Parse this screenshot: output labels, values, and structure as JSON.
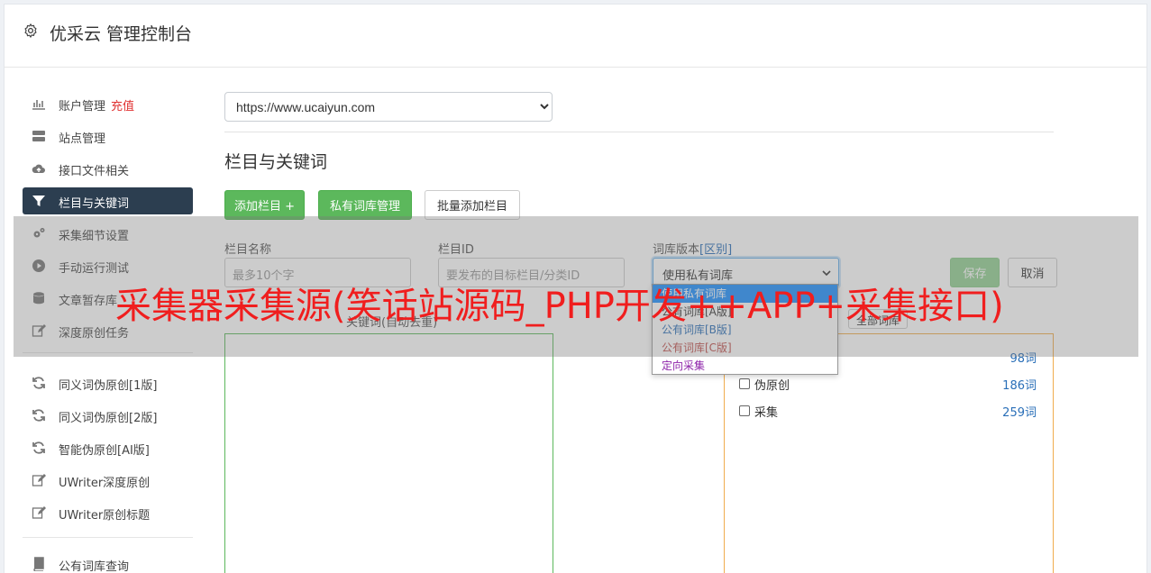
{
  "header": {
    "title": "优采云 管理控制台",
    "icon": "gear-icon"
  },
  "sidebar": {
    "items": [
      {
        "label": "账户管理",
        "extra": "充值",
        "icon": "bar-chart-icon"
      },
      {
        "label": "站点管理",
        "icon": "server-icon"
      },
      {
        "label": "接口文件相关",
        "icon": "cloud-upload-icon"
      },
      {
        "label": "栏目与关键词",
        "icon": "filter-icon",
        "active": true
      },
      {
        "label": "采集细节设置",
        "icon": "cogs-icon"
      },
      {
        "label": "手动运行测试",
        "icon": "play-circle-icon"
      },
      {
        "label": "文章暂存库",
        "icon": "database-icon"
      },
      {
        "label": "深度原创任务",
        "icon": "edit-icon"
      },
      {
        "label": "同义词伪原创[1版]",
        "icon": "refresh-icon"
      },
      {
        "label": "同义词伪原创[2版]",
        "icon": "refresh-icon"
      },
      {
        "label": "智能伪原创[AI版]",
        "icon": "refresh-icon"
      },
      {
        "label": "UWriter深度原创",
        "icon": "edit-icon"
      },
      {
        "label": "UWriter原创标题",
        "icon": "edit-icon"
      },
      {
        "label": "公有词库查询",
        "icon": "book-icon"
      }
    ]
  },
  "main": {
    "site_select": {
      "value": "https://www.ucaiyun.com"
    },
    "section_title": "栏目与关键词",
    "buttons": {
      "add_column": "添加栏目 +",
      "private_lib": "私有词库管理",
      "batch_add": "批量添加栏目"
    },
    "form": {
      "col_name_label": "栏目名称",
      "col_name_placeholder": "最多10个字",
      "col_id_label": "栏目ID",
      "col_id_placeholder": "要发布的目标栏目/分类ID",
      "lib_version_label": "词库版本",
      "lib_version_link": "[区别]",
      "lib_version_value": "使用私有词库",
      "save": "保存",
      "cancel": "取消"
    },
    "left_box_label": "关键词(自动去重)",
    "select_all": "全部词库",
    "libraries": [
      {
        "name": "",
        "count": "98词"
      },
      {
        "name": "伪原创",
        "count": "186词"
      },
      {
        "name": "采集",
        "count": "259词"
      }
    ],
    "dropdown_options": [
      {
        "label": "使用私有词库",
        "color": "#ffffff",
        "selected": true
      },
      {
        "label": "公有词库[A版]",
        "color": "#333333"
      },
      {
        "label": "公有词库[B版]",
        "color": "#2a6fb8"
      },
      {
        "label": "公有词库[C版]",
        "color": "#c0504d"
      },
      {
        "label": "定向采集",
        "color": "#8e24aa"
      }
    ]
  },
  "watermark": "采集器采集源(笑话站源码_PHP开发++APP+采集接口)"
}
